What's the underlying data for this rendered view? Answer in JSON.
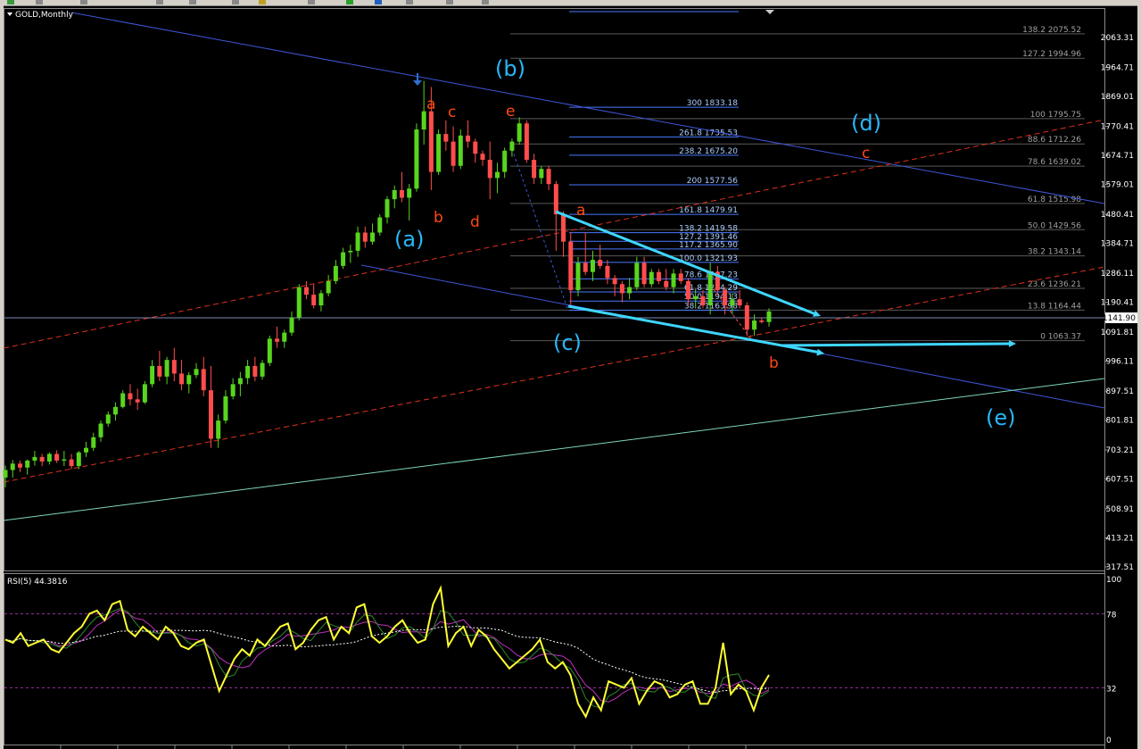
{
  "window": {
    "title": "GOLD,Monthly"
  },
  "colors": {
    "bull": "#58d51e",
    "bear": "#ff4d4d",
    "channel": "#3f56d8",
    "red_dash": "#e0301e",
    "cyan": "#3fd6ff",
    "trend_green": "#7fd6b8",
    "rsi": "#ffff33",
    "wave_blue": "#29b6f6",
    "wave_red": "#ff4a10"
  },
  "price_axis": {
    "ticks": [
      "2063.31",
      "1964.71",
      "1869.01",
      "1770.41",
      "1674.71",
      "1579.01",
      "1480.41",
      "1384.71",
      "1286.11",
      "1190.41",
      "1091.81",
      "996.11",
      "897.51",
      "801.81",
      "703.21",
      "607.51",
      "508.91",
      "413.21",
      "317.51"
    ],
    "current_price": "1141.90"
  },
  "fib_right": [
    {
      "level": "138.2",
      "price": "2075.52"
    },
    {
      "level": "127.2",
      "price": "1994.96"
    },
    {
      "level": "100",
      "price": "1795.75"
    },
    {
      "level": "88.6",
      "price": "1712.26"
    },
    {
      "level": "78.6",
      "price": "1639.02"
    },
    {
      "level": "61.8",
      "price": "1515.98"
    },
    {
      "level": "50.0",
      "price": "1429.56"
    },
    {
      "level": "38.2",
      "price": "1343.14"
    },
    {
      "level": "23.6",
      "price": "1236.21"
    },
    {
      "level": "13.8",
      "price": "1164.44"
    },
    {
      "level": "0",
      "price": "1063.37"
    }
  ],
  "fib_blue": [
    {
      "level": "300",
      "price": "1833.18"
    },
    {
      "level": "261.8",
      "price": "1735.53"
    },
    {
      "level": "238.2",
      "price": "1675.20"
    },
    {
      "level": "200",
      "price": "1577.56"
    },
    {
      "level": "161.8",
      "price": "1479.91"
    },
    {
      "level": "138.2",
      "price": "1419.58"
    },
    {
      "level": "127.2",
      "price": "1391.46"
    },
    {
      "level": "117.2",
      "price": "1365.90"
    },
    {
      "level": "100.0",
      "price": "1321.93"
    },
    {
      "level": "78.6",
      "price": "1267.23"
    },
    {
      "level": "61.8",
      "price": "1224.29"
    },
    {
      "level": "50.0",
      "price": "1194.13"
    },
    {
      "level": "38.2",
      "price": "1163.98"
    }
  ],
  "wave_labels": {
    "major": [
      "(a)",
      "(b)",
      "(c)",
      "(d)",
      "(e)"
    ],
    "minor": [
      "a",
      "c",
      "e",
      "b",
      "d",
      "a",
      "b",
      "c"
    ]
  },
  "rsi": {
    "title": "RSI(5) 44.3816",
    "levels": [
      "100",
      "78",
      "32",
      "0"
    ]
  },
  "chart_data": {
    "type": "candlestick",
    "title": "GOLD,Monthly",
    "ylim": [
      317.51,
      2063.31
    ],
    "candles": [
      [
        612,
        652,
        580,
        637
      ],
      [
        637,
        670,
        612,
        658
      ],
      [
        658,
        668,
        630,
        645
      ],
      [
        645,
        672,
        622,
        668
      ],
      [
        668,
        700,
        652,
        680
      ],
      [
        680,
        690,
        650,
        665
      ],
      [
        665,
        695,
        655,
        690
      ],
      [
        690,
        702,
        660,
        668
      ],
      [
        668,
        700,
        650,
        672
      ],
      [
        672,
        690,
        640,
        650
      ],
      [
        650,
        700,
        640,
        695
      ],
      [
        695,
        730,
        680,
        710
      ],
      [
        710,
        760,
        700,
        745
      ],
      [
        745,
        800,
        730,
        790
      ],
      [
        790,
        830,
        780,
        820
      ],
      [
        820,
        860,
        800,
        845
      ],
      [
        845,
        900,
        840,
        890
      ],
      [
        890,
        920,
        850,
        870
      ],
      [
        870,
        905,
        835,
        860
      ],
      [
        860,
        930,
        855,
        920
      ],
      [
        920,
        1000,
        910,
        980
      ],
      [
        980,
        1030,
        930,
        945
      ],
      [
        945,
        1010,
        920,
        1000
      ],
      [
        1000,
        1040,
        930,
        955
      ],
      [
        955,
        1000,
        900,
        920
      ],
      [
        920,
        960,
        890,
        950
      ],
      [
        950,
        990,
        940,
        970
      ],
      [
        970,
        1010,
        880,
        900
      ],
      [
        900,
        980,
        710,
        740
      ],
      [
        740,
        820,
        710,
        800
      ],
      [
        800,
        900,
        790,
        880
      ],
      [
        880,
        940,
        870,
        920
      ],
      [
        920,
        960,
        880,
        940
      ],
      [
        940,
        1000,
        920,
        980
      ],
      [
        980,
        1010,
        930,
        945
      ],
      [
        945,
        1000,
        935,
        990
      ],
      [
        990,
        1080,
        980,
        1070
      ],
      [
        1070,
        1110,
        1040,
        1060
      ],
      [
        1060,
        1100,
        1040,
        1090
      ],
      [
        1090,
        1160,
        1080,
        1140
      ],
      [
        1140,
        1250,
        1130,
        1240
      ],
      [
        1240,
        1260,
        1200,
        1215
      ],
      [
        1215,
        1250,
        1170,
        1180
      ],
      [
        1180,
        1230,
        1160,
        1220
      ],
      [
        1220,
        1280,
        1210,
        1260
      ],
      [
        1260,
        1330,
        1250,
        1310
      ],
      [
        1310,
        1370,
        1300,
        1355
      ],
      [
        1355,
        1380,
        1320,
        1360
      ],
      [
        1360,
        1440,
        1340,
        1420
      ],
      [
        1420,
        1440,
        1370,
        1390
      ],
      [
        1390,
        1450,
        1380,
        1420
      ],
      [
        1420,
        1480,
        1410,
        1470
      ],
      [
        1470,
        1540,
        1450,
        1530
      ],
      [
        1530,
        1575,
        1500,
        1560
      ],
      [
        1560,
        1620,
        1520,
        1535
      ],
      [
        1535,
        1580,
        1460,
        1565
      ],
      [
        1565,
        1780,
        1555,
        1760
      ],
      [
        1760,
        1920,
        1710,
        1820
      ],
      [
        1820,
        1900,
        1560,
        1620
      ],
      [
        1620,
        1760,
        1610,
        1745
      ],
      [
        1745,
        1790,
        1690,
        1720
      ],
      [
        1720,
        1770,
        1620,
        1640
      ],
      [
        1640,
        1760,
        1630,
        1740
      ],
      [
        1740,
        1790,
        1700,
        1720
      ],
      [
        1720,
        1730,
        1650,
        1680
      ],
      [
        1680,
        1690,
        1640,
        1660
      ],
      [
        1660,
        1720,
        1530,
        1600
      ],
      [
        1600,
        1650,
        1550,
        1620
      ],
      [
        1620,
        1700,
        1600,
        1690
      ],
      [
        1690,
        1730,
        1670,
        1720
      ],
      [
        1720,
        1800,
        1710,
        1780
      ],
      [
        1780,
        1790,
        1650,
        1660
      ],
      [
        1660,
        1680,
        1580,
        1600
      ],
      [
        1600,
        1640,
        1580,
        1630
      ],
      [
        1630,
        1640,
        1560,
        1580
      ],
      [
        1580,
        1590,
        1360,
        1480
      ],
      [
        1480,
        1490,
        1340,
        1390
      ],
      [
        1390,
        1420,
        1180,
        1230
      ],
      [
        1230,
        1340,
        1210,
        1320
      ],
      [
        1320,
        1420,
        1280,
        1290
      ],
      [
        1290,
        1360,
        1260,
        1330
      ],
      [
        1330,
        1380,
        1300,
        1310
      ],
      [
        1310,
        1330,
        1250,
        1270
      ],
      [
        1270,
        1280,
        1210,
        1250
      ],
      [
        1250,
        1260,
        1190,
        1220
      ],
      [
        1220,
        1270,
        1200,
        1240
      ],
      [
        1240,
        1340,
        1230,
        1320
      ],
      [
        1320,
        1340,
        1240,
        1250
      ],
      [
        1250,
        1300,
        1240,
        1290
      ],
      [
        1290,
        1300,
        1250,
        1260
      ],
      [
        1260,
        1300,
        1230,
        1240
      ],
      [
        1240,
        1300,
        1220,
        1285
      ],
      [
        1285,
        1300,
        1250,
        1260
      ],
      [
        1260,
        1270,
        1180,
        1200
      ],
      [
        1200,
        1230,
        1170,
        1210
      ],
      [
        1210,
        1230,
        1170,
        1180
      ],
      [
        1180,
        1320,
        1150,
        1290
      ],
      [
        1290,
        1310,
        1220,
        1230
      ],
      [
        1230,
        1240,
        1150,
        1180
      ],
      [
        1180,
        1220,
        1150,
        1200
      ],
      [
        1200,
        1230,
        1170,
        1180
      ],
      [
        1180,
        1190,
        1080,
        1100
      ],
      [
        1100,
        1150,
        1080,
        1130
      ],
      [
        1130,
        1140,
        1120,
        1125
      ],
      [
        1125,
        1170,
        1110,
        1160
      ]
    ],
    "rsi": [
      62,
      60,
      66,
      58,
      60,
      62,
      56,
      54,
      60,
      66,
      70,
      78,
      80,
      74,
      84,
      86,
      68,
      64,
      70,
      66,
      62,
      70,
      66,
      58,
      56,
      60,
      62,
      46,
      30,
      40,
      50,
      56,
      52,
      62,
      58,
      64,
      70,
      72,
      56,
      60,
      68,
      74,
      76,
      62,
      70,
      66,
      82,
      84,
      64,
      60,
      64,
      70,
      74,
      66,
      60,
      62,
      84,
      94,
      58,
      66,
      70,
      58,
      68,
      64,
      56,
      50,
      44,
      48,
      52,
      56,
      62,
      48,
      44,
      48,
      40,
      22,
      14,
      26,
      18,
      36,
      34,
      32,
      38,
      22,
      30,
      36,
      34,
      26,
      28,
      34,
      36,
      22,
      22,
      32,
      60,
      28,
      34,
      30,
      18,
      32,
      40
    ]
  }
}
